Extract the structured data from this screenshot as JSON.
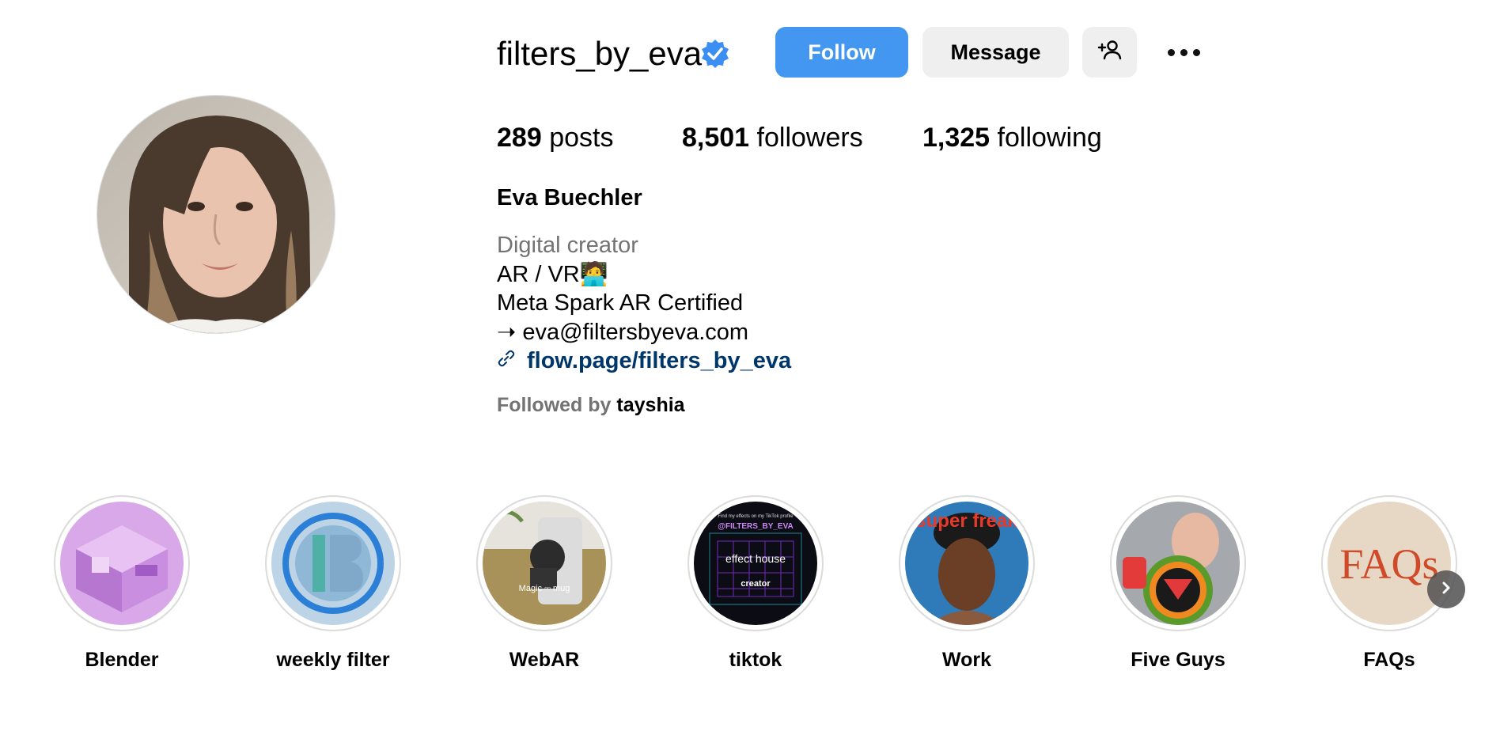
{
  "profile": {
    "username": "filters_by_eva",
    "verified_icon": "verified-badge-icon",
    "full_name": "Eva Buechler"
  },
  "actions": {
    "follow_label": "Follow",
    "message_label": "Message",
    "add_user_icon": "person-add-icon",
    "more_icon": "more-options-icon"
  },
  "stats": {
    "posts_count": "289",
    "posts_label": "posts",
    "followers_count": "8,501",
    "followers_label": "followers",
    "following_count": "1,325",
    "following_label": "following"
  },
  "bio": {
    "category": "Digital creator",
    "line1": "AR / VR🧑‍💻",
    "line2": "Meta Spark AR Certified",
    "line3": "➝ eva@filtersbyeva.com",
    "link_text": "flow.page/filters_by_eva"
  },
  "followed_by": {
    "prefix": "Followed by",
    "user": "tayshia"
  },
  "highlights": [
    {
      "label": "Blender"
    },
    {
      "label": "weekly filter"
    },
    {
      "label": "WebAR"
    },
    {
      "label": "tiktok"
    },
    {
      "label": "Work"
    },
    {
      "label": "Five Guys"
    },
    {
      "label": "FAQs"
    }
  ],
  "highlight_texts": {
    "webar_caption": "Magic ▫▫ mug",
    "tiktok_top": "Find my effects on my TikTok profile",
    "tiktok_handle": "@FILTERS_BY_EVA",
    "tiktok_brand": "effect house",
    "tiktok_role": "creator",
    "work_text": "super freak",
    "faq_text": "FAQs"
  },
  "colors": {
    "follow_blue": "#4397f0",
    "link_blue": "#00376b",
    "secondary_gray": "#737373",
    "button_gray": "#efefef"
  }
}
